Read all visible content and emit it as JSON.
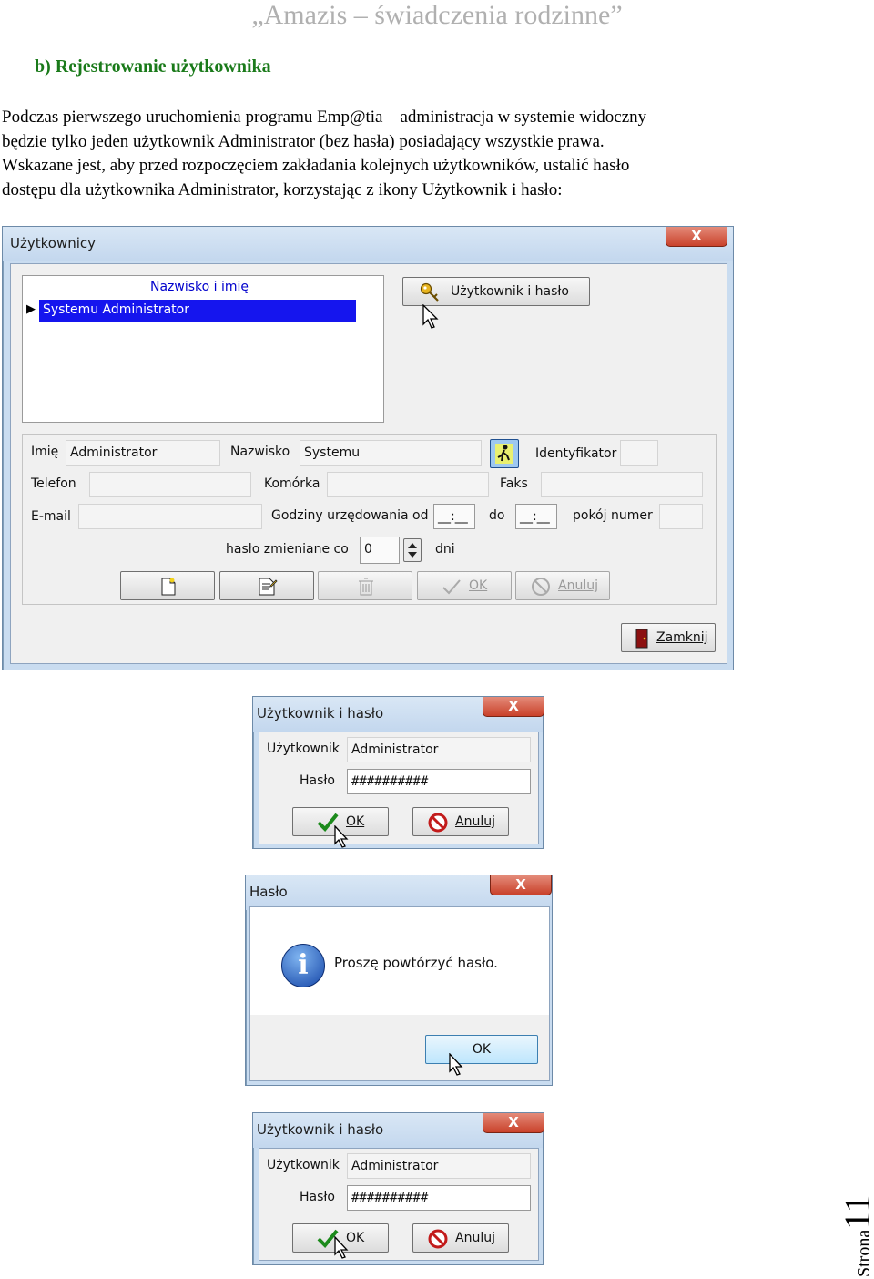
{
  "header": {
    "title": "„Amazis – świadczenia rodzinne”"
  },
  "section": {
    "title": "b)  Rejestrowanie użytkownika"
  },
  "paragraph": {
    "line1": "Podczas pierwszego uruchomienia programu Emp@tia – administracja w systemie widoczny",
    "line2": "będzie tylko jeden użytkownik Administrator (bez hasła) posiadający wszystkie prawa.",
    "line3": "Wskazane jest, aby przed rozpoczęciem zakładania kolejnych użytkowników, ustalić hasło",
    "line4": "dostępu dla użytkownika Administrator, korzystając z ikony Użytkownik i hasło:"
  },
  "users_window": {
    "title": "Użytkownicy",
    "close_glyph": "X",
    "grid": {
      "column_header": "Nazwisko i imię",
      "rows": [
        "Systemu Administrator"
      ],
      "row_marker": "▶"
    },
    "user_password_button": "Użytkownik i hasło",
    "labels": {
      "first_name": "Imię",
      "last_name": "Nazwisko",
      "identifier": "Identyfikator",
      "phone": "Telefon",
      "mobile": "Komórka",
      "fax": "Faks",
      "email": "E-mail",
      "office_hours_from": "Godziny urzędowania od",
      "to": "do",
      "room_number": "pokój numer",
      "password_changed_every": "hasło zmieniane co",
      "days": "dni"
    },
    "values": {
      "first_name": "Administrator",
      "last_name": "Systemu",
      "identifier": "",
      "phone": "",
      "mobile": "",
      "fax": "",
      "email": "",
      "hours_from": "__:__",
      "hours_to": "__:__",
      "room_number": "",
      "password_interval": "0"
    },
    "buttons": {
      "ok": "OK",
      "cancel": "Anuluj",
      "close": "Zamknij"
    }
  },
  "user_password_dialog_1": {
    "title": "Użytkownik i hasło",
    "close_glyph": "X",
    "user_label": "Użytkownik",
    "user_value": "Administrator",
    "password_label": "Hasło",
    "password_value": "##########",
    "ok": "OK",
    "cancel": "Anuluj"
  },
  "password_message": {
    "title": "Hasło",
    "close_glyph": "X",
    "info_glyph": "i",
    "message": "Proszę powtórzyć hasło.",
    "ok": "OK"
  },
  "user_password_dialog_2": {
    "title": "Użytkownik i hasło",
    "close_glyph": "X",
    "user_label": "Użytkownik",
    "user_value": "Administrator",
    "password_label": "Hasło",
    "password_value": "##########",
    "ok": "OK",
    "cancel": "Anuluj"
  },
  "page": {
    "word": "Strona",
    "number": "11"
  },
  "colors": {
    "section_title": "#1a7a1a",
    "header": "#b0b0b0",
    "grid_selection": "#1515ee",
    "window_frame": "#c9dcf0"
  }
}
